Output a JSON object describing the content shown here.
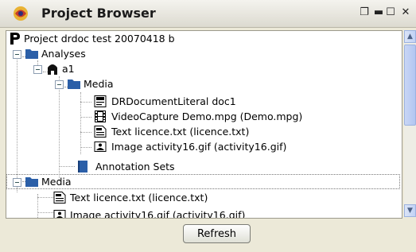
{
  "window": {
    "title": "Project Browser",
    "controls": {
      "restore": "❐",
      "minimize": "▬",
      "maximize": "☐",
      "close": "✕"
    }
  },
  "tree": {
    "items": [
      {
        "label": "Project drdoc test 20070418 b",
        "icon": "project-p-icon"
      },
      {
        "label": "Analyses",
        "icon": "folder-icon"
      },
      {
        "label": "a1",
        "icon": "analysis-icon"
      },
      {
        "label": "Media",
        "icon": "folder-icon"
      },
      {
        "label": "DRDocumentLiteral doc1",
        "icon": "document-icon"
      },
      {
        "label": "VideoCapture Demo.mpg (Demo.mpg)",
        "icon": "film-icon"
      },
      {
        "label": "Text licence.txt (licence.txt)",
        "icon": "text-file-icon"
      },
      {
        "label": "Image activity16.gif (activity16.gif)",
        "icon": "image-icon"
      },
      {
        "label": "Annotation Sets",
        "icon": "notebook-icon"
      },
      {
        "label": "Media",
        "icon": "folder-icon"
      },
      {
        "label": "Text licence.txt (licence.txt)",
        "icon": "text-file-icon"
      },
      {
        "label": "Image activity16.gif (activity16.gif)",
        "icon": "image-icon"
      }
    ]
  },
  "buttons": {
    "refresh": "Refresh"
  },
  "colors": {
    "folder": "#2b5fa8",
    "selection_border": "#777777",
    "scroll_thumb": "#b2c6f1"
  }
}
